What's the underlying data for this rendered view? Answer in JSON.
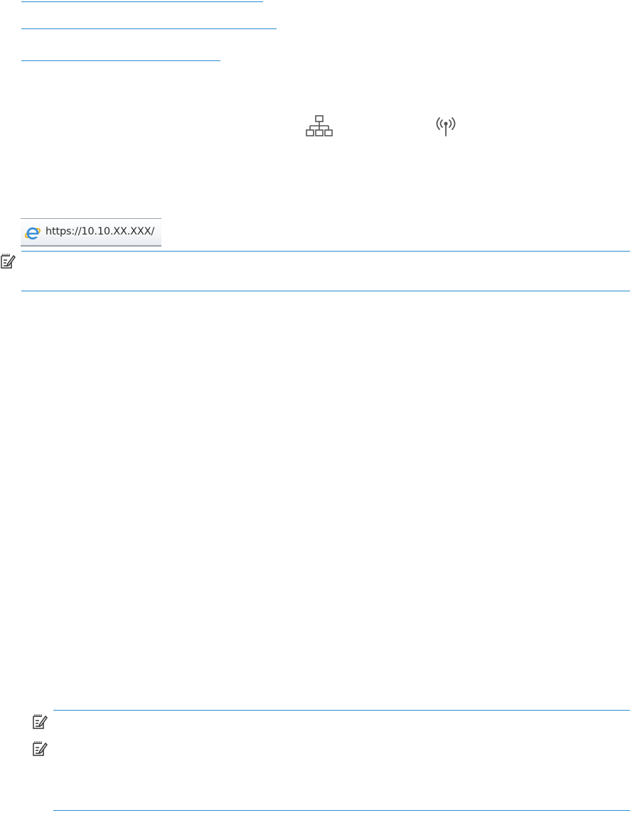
{
  "address_bar": {
    "url": "https://10.10.XX.XXX/"
  },
  "icons": {
    "network": "network-icon",
    "wireless": "wireless-icon",
    "note": "note-icon",
    "browser": "internet-explorer-icon"
  },
  "colors": {
    "link_rule": "#2a8ccf",
    "icon_gray": "#555555"
  }
}
